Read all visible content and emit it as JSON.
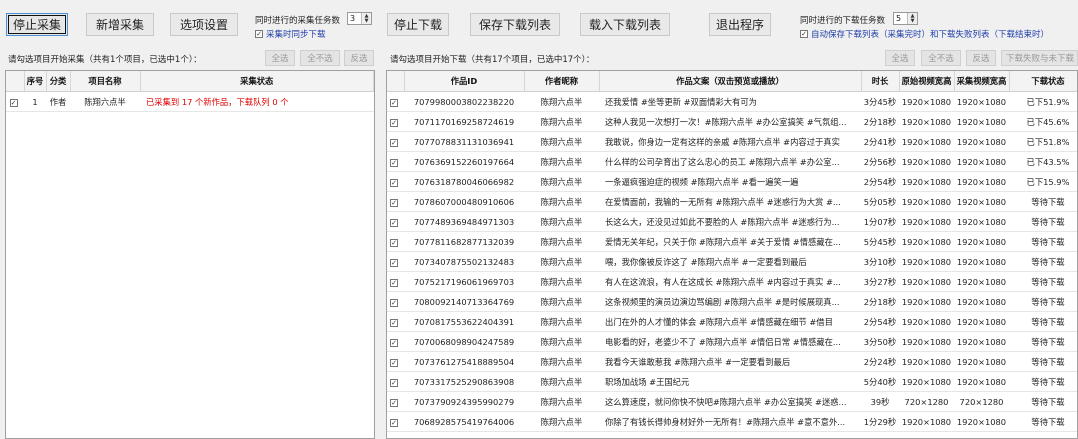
{
  "toolbar_left": {
    "stop_collect": "停止采集",
    "add_collect": "新增采集",
    "options": "选项设置",
    "concurrent_label": "同时进行的采集任务数",
    "concurrent_value": "3",
    "sync_download_label": "采集时同步下载",
    "sync_download_checked": true
  },
  "toolbar_right": {
    "stop_download": "停止下载",
    "save_list": "保存下载列表",
    "load_list": "载入下载列表",
    "exit": "退出程序",
    "concurrent_label": "同时进行的下载任务数",
    "concurrent_value": "5",
    "auto_save_label": "自动保存下载列表（采集完时）和下载失败列表（下载结束时）",
    "auto_save_checked": true
  },
  "left_panel": {
    "hint": "请勾选项目开始采集（共有1个项目，已选中1个）：",
    "select_all": "全选",
    "select_none": "全不选",
    "invert": "反选",
    "columns": [
      "序号",
      "分类",
      "项目名称",
      "采集状态"
    ],
    "rows": [
      {
        "checked": true,
        "index": "1",
        "category": "作者",
        "name": "陈翔六点半",
        "status": "已采集到 17 个新作品，下载队列 0 个"
      }
    ]
  },
  "right_panel": {
    "hint": "请勾选项目开始下载（共有17个项目，已选中17个）：",
    "select_all": "全选",
    "select_none": "全不选",
    "invert": "反选",
    "failed_button": "下载失败与未下载",
    "columns": [
      "作品ID",
      "作者昵称",
      "作品文案（双击预览或播放）",
      "时长",
      "原始视频宽高",
      "采集视频宽高",
      "下载状态"
    ],
    "rows": [
      {
        "checked": true,
        "id": "7079980003802238220",
        "author": "陈翔六点半",
        "caption": "还我爱情 #坐等更新 #双面情彩大有可为",
        "duration": "3分45秒",
        "orig": "1920×1080",
        "coll": "1920×1080",
        "status": "已下51.9%"
      },
      {
        "checked": true,
        "id": "7071170169258724619",
        "author": "陈翔六点半",
        "caption": "这种人我见一次想打一次！#陈翔六点半 #办公室搞笑 #气氛组...",
        "duration": "2分18秒",
        "orig": "1920×1080",
        "coll": "1920×1080",
        "status": "已下45.6%"
      },
      {
        "checked": true,
        "id": "7077078831131036941",
        "author": "陈翔六点半",
        "caption": "我敢说，你身边一定有这样的亲戚 #陈翔六点半 #内容过于真实",
        "duration": "2分41秒",
        "orig": "1920×1080",
        "coll": "1920×1080",
        "status": "已下51.8%"
      },
      {
        "checked": true,
        "id": "7076369152260197664",
        "author": "陈翔六点半",
        "caption": "什么样的公司孕育出了这么忠心的员工 #陈翔六点半 #办公室...",
        "duration": "2分56秒",
        "orig": "1920×1080",
        "coll": "1920×1080",
        "status": "已下43.5%"
      },
      {
        "checked": true,
        "id": "7076318780046066982",
        "author": "陈翔六点半",
        "caption": "一条逼疯强迫症的视频 #陈翔六点半 #看一遍笑一遍",
        "duration": "2分54秒",
        "orig": "1920×1080",
        "coll": "1920×1080",
        "status": "已下15.9%"
      },
      {
        "checked": true,
        "id": "7078607000480910606",
        "author": "陈翔六点半",
        "caption": "在爱情面前，我输的一无所有 #陈翔六点半 #迷惑行为大赏 #...",
        "duration": "5分05秒",
        "orig": "1920×1080",
        "coll": "1920×1080",
        "status": "等待下载"
      },
      {
        "checked": true,
        "id": "7077489369484971303",
        "author": "陈翔六点半",
        "caption": "长这么大，还没见过如此不要脸的人 #陈翔六点半 #迷惑行为...",
        "duration": "1分07秒",
        "orig": "1920×1080",
        "coll": "1920×1080",
        "status": "等待下载"
      },
      {
        "checked": true,
        "id": "7077811682877132039",
        "author": "陈翔六点半",
        "caption": "爱情无关年纪，只关于你 #陈翔六点半 #关于爱情 #情感藏在...",
        "duration": "5分45秒",
        "orig": "1920×1080",
        "coll": "1920×1080",
        "status": "等待下载"
      },
      {
        "checked": true,
        "id": "7073407875502132483",
        "author": "陈翔六点半",
        "caption": "喂，我你像被反诈这了 #陈翔六点半 #一定要看到最后",
        "duration": "3分10秒",
        "orig": "1920×1080",
        "coll": "1920×1080",
        "status": "等待下载"
      },
      {
        "checked": true,
        "id": "7075217196061969703",
        "author": "陈翔六点半",
        "caption": "有人在这流浪，有人在这成长 #陈翔六点半 #内容过于真实 #...",
        "duration": "3分27秒",
        "orig": "1920×1080",
        "coll": "1920×1080",
        "status": "等待下载"
      },
      {
        "checked": true,
        "id": "7080092140713364769",
        "author": "陈翔六点半",
        "caption": "这条视频里的演员边演边骂编剧 #陈翔六点半 #是时候展现真...",
        "duration": "2分18秒",
        "orig": "1920×1080",
        "coll": "1920×1080",
        "status": "等待下载"
      },
      {
        "checked": true,
        "id": "7070817553622404391",
        "author": "陈翔六点半",
        "caption": "出门在外的人才懂的体会 #陈翔六点半 #情感藏在细节 #借目",
        "duration": "2分54秒",
        "orig": "1920×1080",
        "coll": "1920×1080",
        "status": "等待下载"
      },
      {
        "checked": true,
        "id": "7070068098904247589",
        "author": "陈翔六点半",
        "caption": "电影看的好，老婆少不了 #陈翔六点半 #情侣日常 #情感藏在...",
        "duration": "3分50秒",
        "orig": "1920×1080",
        "coll": "1920×1080",
        "status": "等待下载"
      },
      {
        "checked": true,
        "id": "7073761275418889504",
        "author": "陈翔六点半",
        "caption": "我看今天谁敢惹我 #陈翔六点半 #一定要看到最后",
        "duration": "2分24秒",
        "orig": "1920×1080",
        "coll": "1920×1080",
        "status": "等待下载"
      },
      {
        "checked": true,
        "id": "7073317525290863908",
        "author": "陈翔六点半",
        "caption": "职场加战场 #王国纪元",
        "duration": "5分40秒",
        "orig": "1920×1080",
        "coll": "1920×1080",
        "status": "等待下载"
      },
      {
        "checked": true,
        "id": "7073790924395990279",
        "author": "陈翔六点半",
        "caption": "这么算速度，就问你快不快吧#陈翔六点半 #办公室搞笑 #迷惑...",
        "duration": "39秒",
        "orig": "720×1280",
        "coll": "720×1280",
        "status": "等待下载"
      },
      {
        "checked": true,
        "id": "7068928575419764006",
        "author": "陈翔六点半",
        "caption": "你除了有钱长得帅身材好外一无所有！#陈翔六点半 #意不意外...",
        "duration": "1分29秒",
        "orig": "1920×1080",
        "coll": "1920×1080",
        "status": "等待下载"
      }
    ]
  }
}
